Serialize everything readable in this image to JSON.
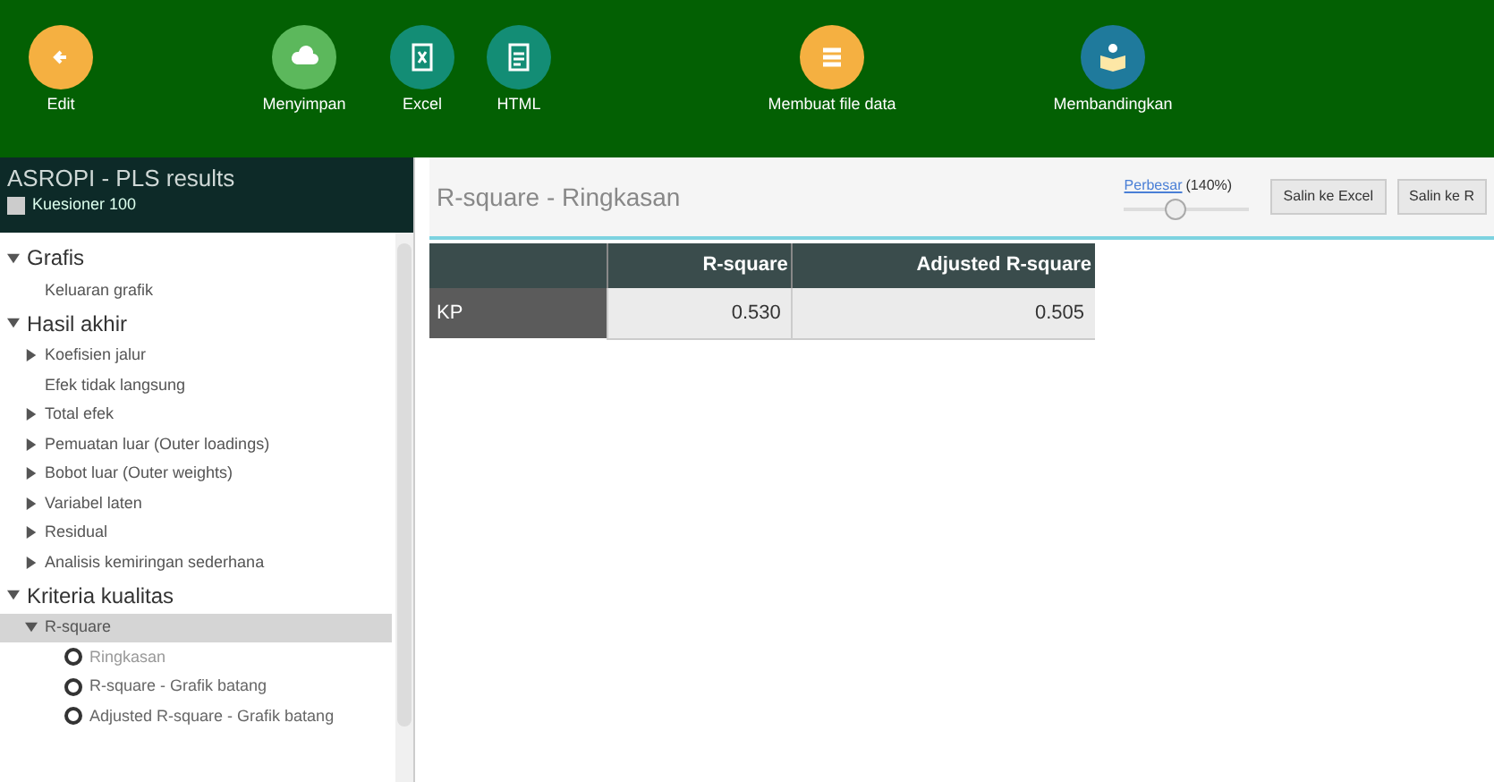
{
  "toolbar": [
    {
      "label": "Edit"
    },
    {
      "label": "Menyimpan"
    },
    {
      "label": "Excel"
    },
    {
      "label": "HTML"
    },
    {
      "label": "Membuat file data"
    },
    {
      "label": "Membandingkan"
    }
  ],
  "sidebar": {
    "title": "ASROPI - PLS results",
    "subtitle": "Kuesioner 100",
    "tree": [
      {
        "label": "Grafis",
        "expanded": true,
        "selected": false,
        "children": [
          {
            "label": "Keluaran grafik",
            "selected": false
          }
        ]
      },
      {
        "label": "Hasil akhir",
        "expanded": true,
        "selected": false,
        "children": [
          {
            "label": "Koefisien jalur",
            "expanded": false,
            "selected": false
          },
          {
            "label": "Efek tidak langsung",
            "selected": false
          },
          {
            "label": "Total efek",
            "expanded": false,
            "selected": false
          },
          {
            "label": "Pemuatan luar (Outer loadings)",
            "expanded": false,
            "selected": false
          },
          {
            "label": "Bobot luar (Outer weights)",
            "expanded": false,
            "selected": false
          },
          {
            "label": "Variabel laten",
            "expanded": false,
            "selected": false
          },
          {
            "label": "Residual",
            "expanded": false,
            "selected": false
          },
          {
            "label": "Analisis kemiringan sederhana",
            "expanded": false,
            "selected": false
          }
        ]
      },
      {
        "label": "Kriteria kualitas",
        "expanded": true,
        "selected": false,
        "children": [
          {
            "label": "R-square",
            "expanded": true,
            "selected": true,
            "children": [
              {
                "kind": "view",
                "label": "Ringkasan",
                "selected": true
              },
              {
                "kind": "view",
                "label": "R-square - Grafik batang",
                "selected": false
              },
              {
                "kind": "view",
                "label": "Adjusted R-square - Grafik batang",
                "selected": false
              }
            ]
          }
        ]
      }
    ]
  },
  "main": {
    "title": "R-square - Ringkasan",
    "zoom": {
      "link": "Perbesar",
      "reading": "(140%)",
      "level": 0.4
    },
    "buttons": [
      "Salin ke Excel",
      "Salin ke R"
    ],
    "table": {
      "columns": [
        "R-square",
        "Adjusted R-square"
      ],
      "rows": [
        {
          "label": "KP",
          "cells": [
            "0.530",
            "0.505"
          ]
        }
      ]
    }
  }
}
